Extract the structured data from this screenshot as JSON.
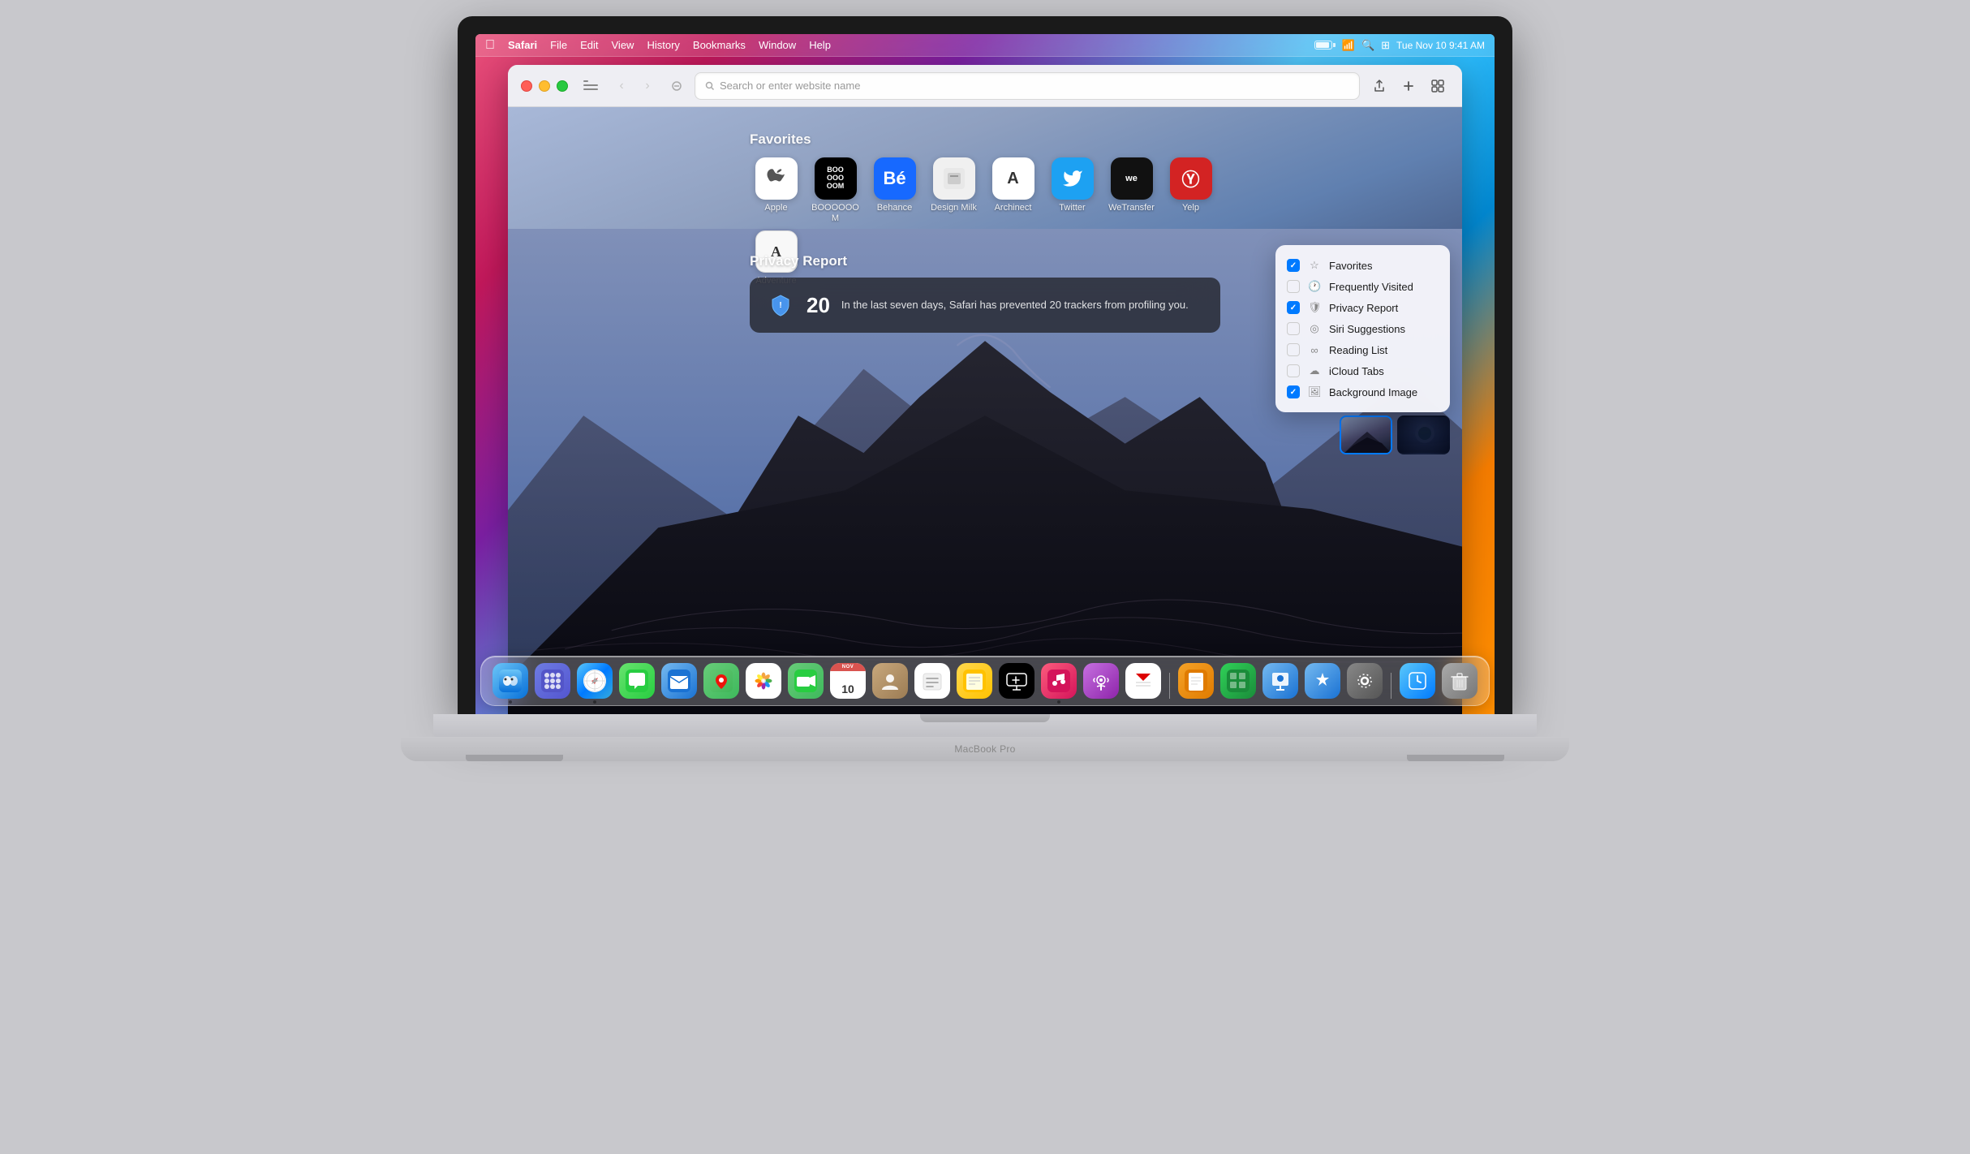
{
  "menubar": {
    "apple": "🍎",
    "app_name": "Safari",
    "menu_items": [
      "File",
      "Edit",
      "View",
      "History",
      "Bookmarks",
      "Window",
      "Help"
    ],
    "time": "Tue Nov 10  9:41 AM"
  },
  "toolbar": {
    "search_placeholder": "Search or enter website name",
    "back_label": "‹",
    "forward_label": "›"
  },
  "favorites": {
    "title": "Favorites",
    "items": [
      {
        "id": "apple",
        "label": "Apple",
        "icon": "🍎",
        "bg": "#fff"
      },
      {
        "id": "boooom",
        "label": "BOOOOOOM",
        "icon": "BOO\nOOO\nOOM",
        "bg": "#000"
      },
      {
        "id": "behance",
        "label": "Behance",
        "icon": "Bé",
        "bg": "#1769ff"
      },
      {
        "id": "design-milk",
        "label": "Design Milk",
        "icon": "🥛",
        "bg": "#f0f0f0"
      },
      {
        "id": "archinect",
        "label": "Archinect",
        "icon": "A",
        "bg": "#fff"
      },
      {
        "id": "twitter",
        "label": "Twitter",
        "icon": "🐦",
        "bg": "#1da1f2"
      },
      {
        "id": "wetransfer",
        "label": "WeTransfer",
        "icon": "we",
        "bg": "#111"
      },
      {
        "id": "yelp",
        "label": "Yelp",
        "icon": "Ⓨ",
        "bg": "#d32323"
      },
      {
        "id": "adventure",
        "label": "Adventure",
        "icon": "A",
        "bg": "#fff"
      }
    ]
  },
  "privacy_report": {
    "title": "Privacy Report",
    "count": "20",
    "message": "In the last seven days, Safari has prevented 20 trackers from profiling you."
  },
  "customize_panel": {
    "items": [
      {
        "id": "favorites",
        "label": "Favorites",
        "checked": true,
        "icon": "☆"
      },
      {
        "id": "frequently-visited",
        "label": "Frequently Visited",
        "checked": false,
        "icon": "🕐"
      },
      {
        "id": "privacy-report",
        "label": "Privacy Report",
        "checked": true,
        "icon": "🛡"
      },
      {
        "id": "siri-suggestions",
        "label": "Siri Suggestions",
        "checked": false,
        "icon": "◎"
      },
      {
        "id": "reading-list",
        "label": "Reading List",
        "checked": false,
        "icon": "∞"
      },
      {
        "id": "icloud-tabs",
        "label": "iCloud Tabs",
        "checked": false,
        "icon": "☁"
      },
      {
        "id": "background-image",
        "label": "Background Image",
        "checked": true,
        "icon": "🖼"
      }
    ]
  },
  "dock": {
    "items": [
      {
        "id": "finder",
        "label": "Finder",
        "icon": "🔵"
      },
      {
        "id": "launchpad",
        "label": "Launchpad",
        "icon": "⊞"
      },
      {
        "id": "safari",
        "label": "Safari",
        "icon": "🧭"
      },
      {
        "id": "messages",
        "label": "Messages",
        "icon": "💬"
      },
      {
        "id": "mail",
        "label": "Mail",
        "icon": "✉"
      },
      {
        "id": "maps",
        "label": "Maps",
        "icon": "📍"
      },
      {
        "id": "photos",
        "label": "Photos",
        "icon": "🌸"
      },
      {
        "id": "facetime",
        "label": "FaceTime",
        "icon": "📷"
      },
      {
        "id": "calendar",
        "label": "Calendar",
        "icon": "10"
      },
      {
        "id": "contacts",
        "label": "Contacts",
        "icon": "👤"
      },
      {
        "id": "reminders",
        "label": "Reminders",
        "icon": "☑"
      },
      {
        "id": "notes",
        "label": "Notes",
        "icon": "📝"
      },
      {
        "id": "tv",
        "label": "TV",
        "icon": "📺"
      },
      {
        "id": "music",
        "label": "Music",
        "icon": "♪"
      },
      {
        "id": "podcasts",
        "label": "Podcasts",
        "icon": "🎙"
      },
      {
        "id": "news",
        "label": "News",
        "icon": "📰"
      },
      {
        "id": "pages",
        "label": "Pages",
        "icon": "📄"
      },
      {
        "id": "numbers",
        "label": "Numbers",
        "icon": "#"
      },
      {
        "id": "keynote",
        "label": "Keynote",
        "icon": "K"
      },
      {
        "id": "appstore",
        "label": "App Store",
        "icon": "A"
      },
      {
        "id": "syspref",
        "label": "System Preferences",
        "icon": "⚙"
      },
      {
        "id": "screentime",
        "label": "Screen Time",
        "icon": "⏱"
      },
      {
        "id": "trash",
        "label": "Trash",
        "icon": "🗑"
      }
    ]
  },
  "macbook": {
    "label": "MacBook Pro"
  }
}
